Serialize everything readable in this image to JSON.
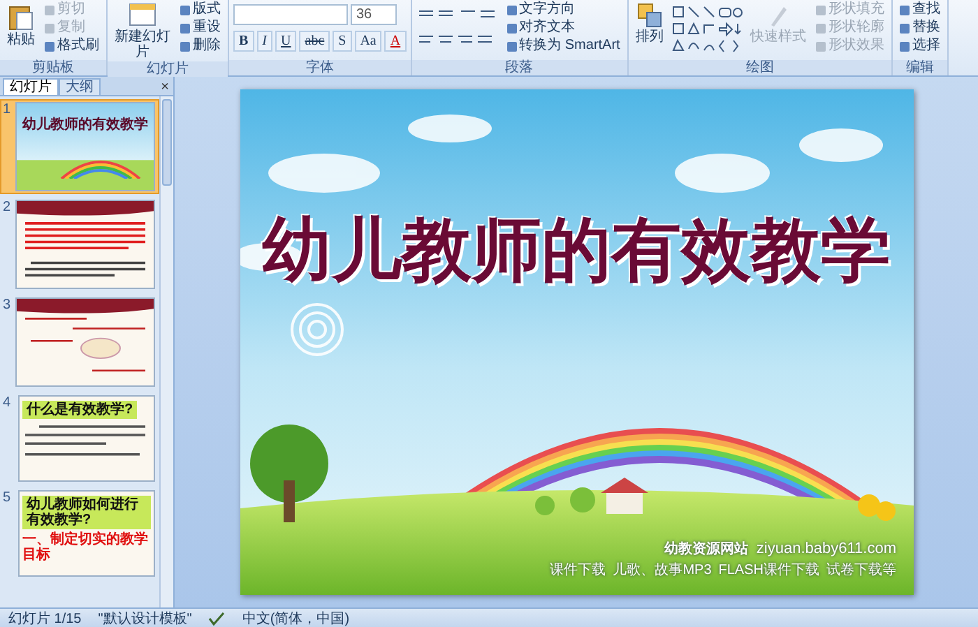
{
  "ribbon": {
    "groups": [
      {
        "kind": "clipboard",
        "label": "剪贴板",
        "big": "粘贴",
        "items": [
          {
            "text": "剪切",
            "disabled": true
          },
          {
            "text": "复制",
            "disabled": true
          },
          {
            "text": "格式刷",
            "disabled": false
          }
        ]
      },
      {
        "kind": "slides",
        "label": "幻灯片",
        "big": "新建幻灯片",
        "items": [
          {
            "text": "版式",
            "disabled": false
          },
          {
            "text": "重设",
            "disabled": false
          },
          {
            "text": "删除",
            "disabled": false
          }
        ]
      },
      {
        "kind": "font",
        "label": "字体",
        "font_size": "36",
        "items": [
          {
            "text": "B",
            "disabled": false
          },
          {
            "text": "I",
            "disabled": false
          },
          {
            "text": "U",
            "disabled": false
          },
          {
            "text": "abc",
            "disabled": false
          },
          {
            "text": "S",
            "disabled": false
          },
          {
            "text": "Aa",
            "disabled": false
          },
          {
            "text": "A",
            "disabled": false
          }
        ]
      },
      {
        "kind": "paragraph",
        "label": "段落",
        "items": [
          {
            "text": "文字方向",
            "disabled": false
          },
          {
            "text": "对齐文本",
            "disabled": false
          },
          {
            "text": "转换为 SmartArt",
            "disabled": false
          }
        ]
      },
      {
        "kind": "drawing",
        "label": "绘图",
        "big": "排列",
        "items": [
          {
            "text": "快速样式",
            "disabled": true
          },
          {
            "text": "形状填充",
            "disabled": true
          },
          {
            "text": "形状轮廓",
            "disabled": true
          },
          {
            "text": "形状效果",
            "disabled": true
          }
        ]
      },
      {
        "kind": "editing",
        "label": "编辑",
        "items": [
          {
            "text": "查找",
            "disabled": false
          },
          {
            "text": "替换",
            "disabled": false
          },
          {
            "text": "选择",
            "disabled": false
          }
        ]
      }
    ]
  },
  "panel": {
    "tabs": [
      {
        "label": "幻灯片",
        "selected": true
      },
      {
        "label": "大纲",
        "selected": false
      }
    ],
    "close": "×",
    "thumbnails": [
      {
        "number": "1",
        "kind": "cover",
        "selected": true,
        "title": "幼儿教师的有效教学"
      },
      {
        "number": "2",
        "kind": "text",
        "selected": false
      },
      {
        "number": "3",
        "kind": "diagram",
        "selected": false
      },
      {
        "number": "4",
        "kind": "heading",
        "selected": false,
        "title": "什么是有效教学?"
      },
      {
        "number": "5",
        "kind": "heading",
        "selected": false,
        "title": "幼儿教师如何进行有效教学?",
        "subtitle": "一、制定切实的教学目标"
      }
    ]
  },
  "slide": {
    "title": "幼儿教师的有效教学",
    "site_name": "幼教资源网站",
    "site_url": "ziyuan.baby611.com",
    "site_links": [
      "课件下载",
      "儿歌、故事MP3",
      "FLASH课件下载",
      "试卷下载等"
    ]
  },
  "status_bar": {
    "slide": "幻灯片 1/15",
    "theme": "\"默认设计模板\"",
    "language": "中文(简体，中国)"
  }
}
